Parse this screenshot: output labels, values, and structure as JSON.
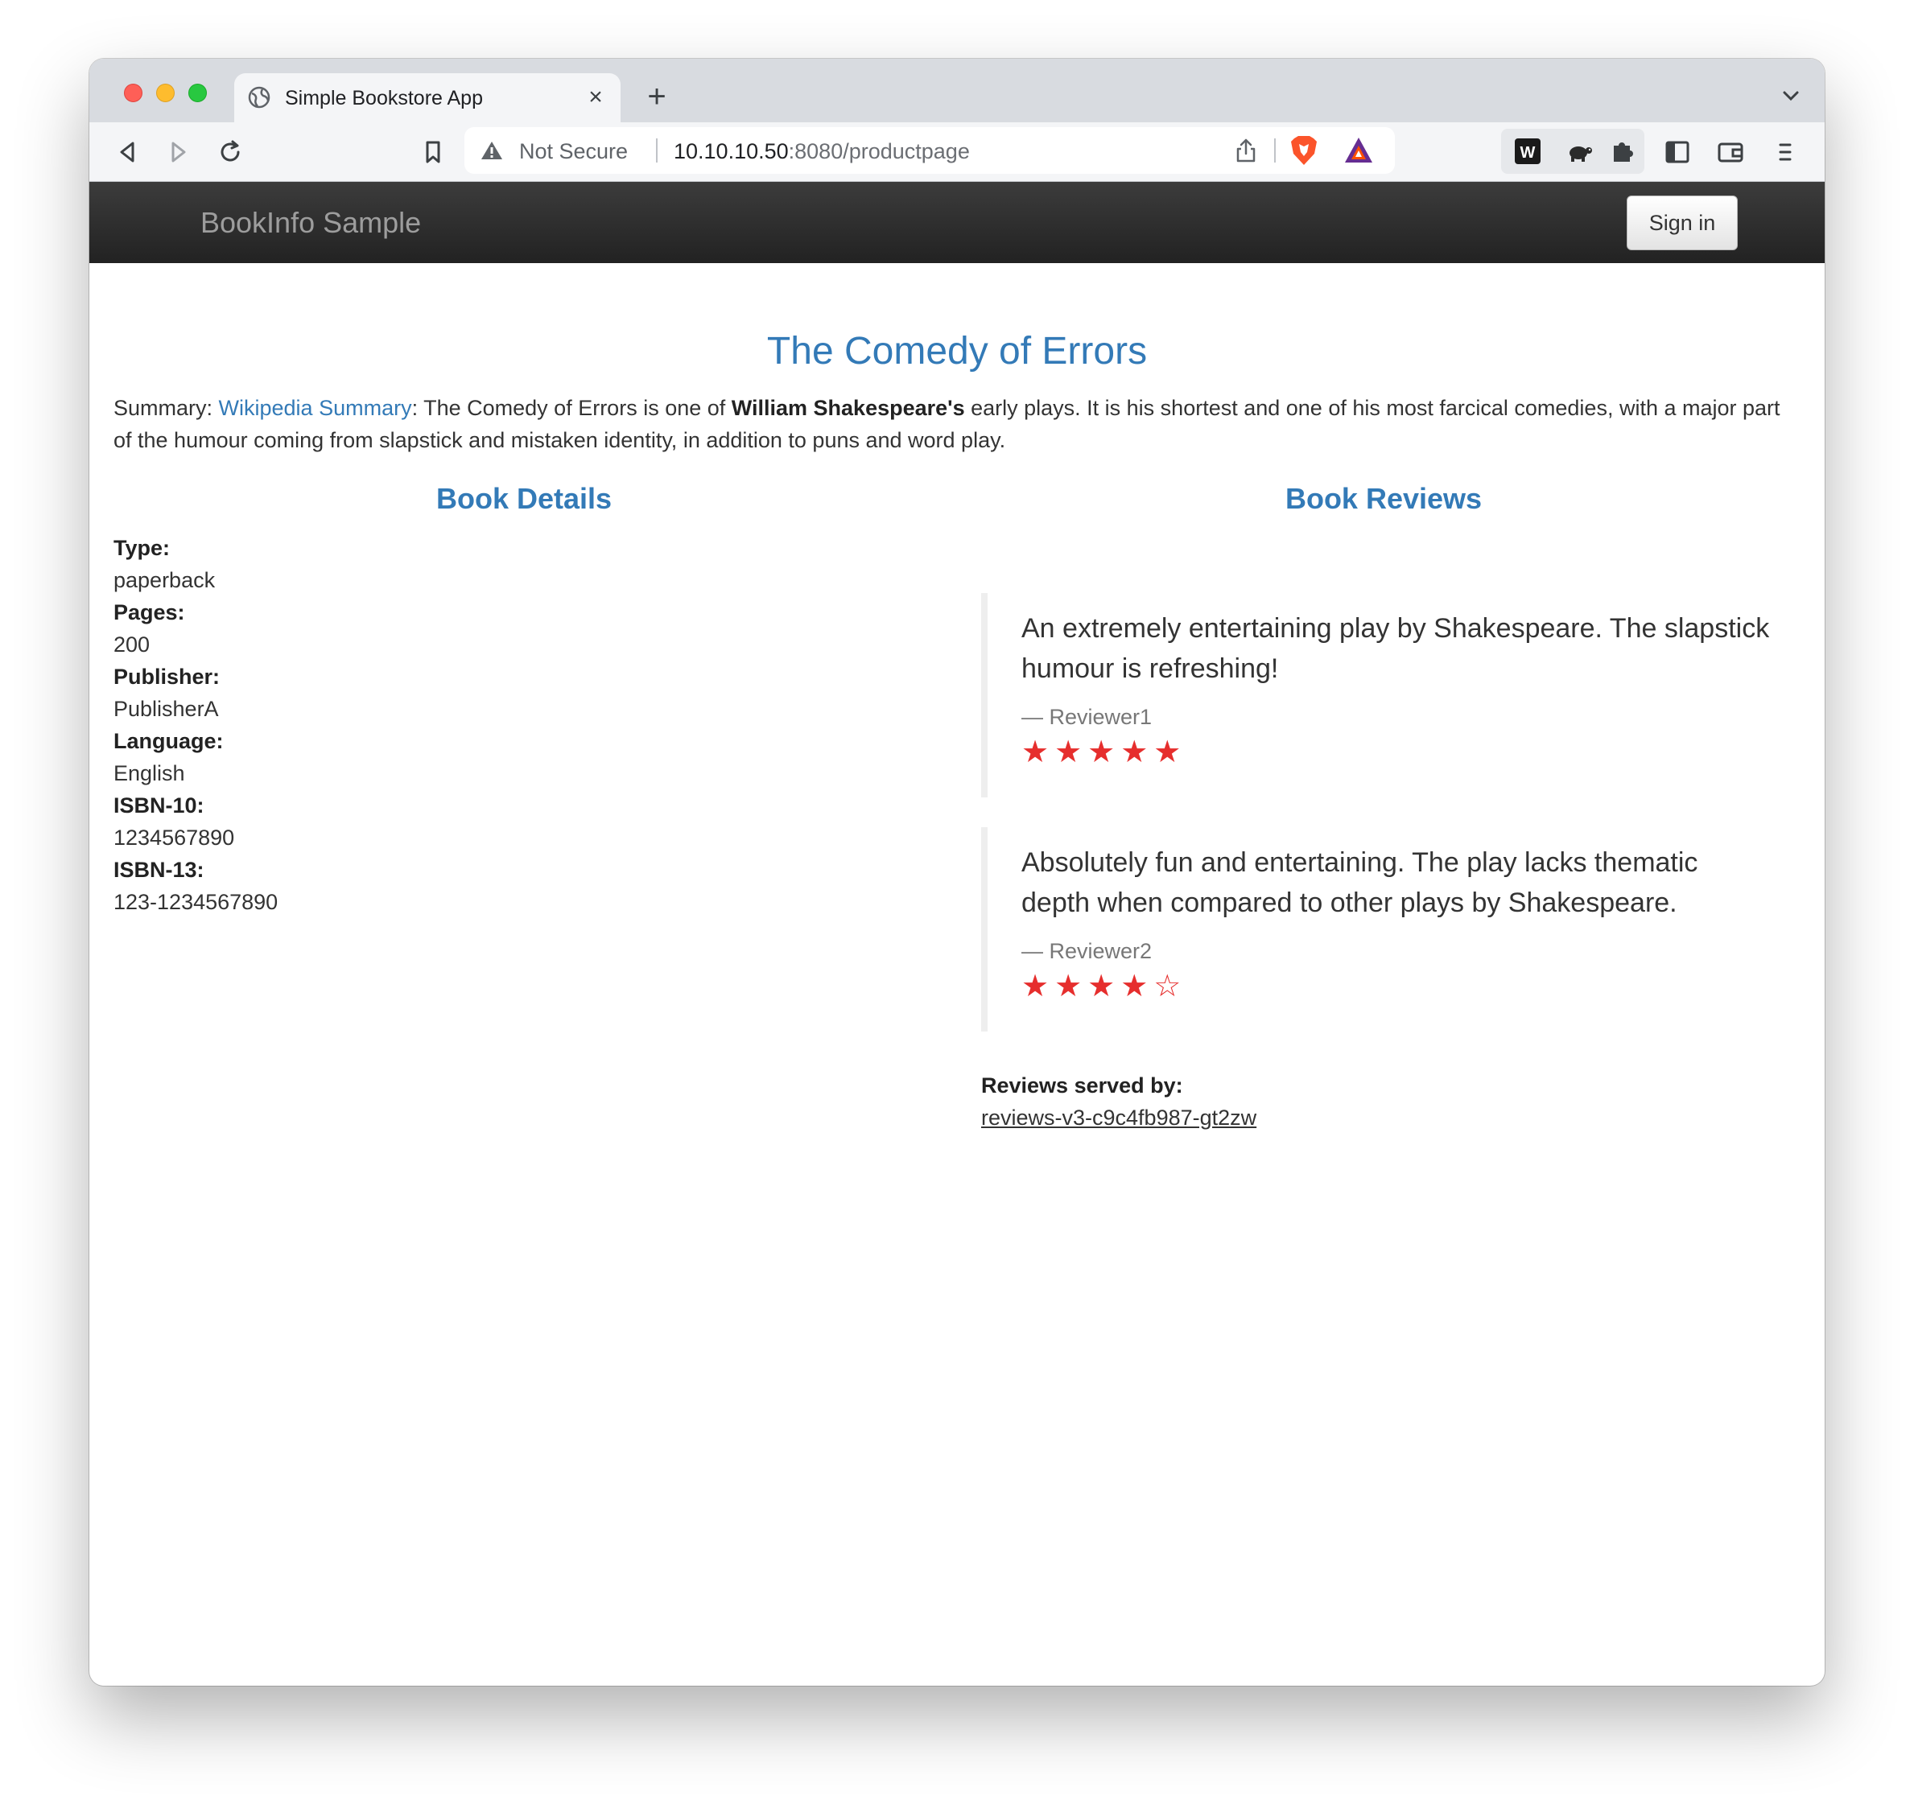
{
  "browser": {
    "tab": {
      "title": "Simple Bookstore App"
    },
    "address": {
      "security_label": "Not Secure",
      "host": "10.10.10.50",
      "path": ":8080/productpage"
    }
  },
  "navbar": {
    "brand": "BookInfo Sample",
    "signin_label": "Sign in"
  },
  "product": {
    "title": "The Comedy of Errors",
    "summary": {
      "label": "Summary: ",
      "link_text": "Wikipedia Summary",
      "text_before_bold": ": The Comedy of Errors is one of ",
      "bold": "William Shakespeare's",
      "text_after_bold": " early plays. It is his shortest and one of his most farcical comedies, with a major part of the humour coming from slapstick and mistaken identity, in addition to puns and word play."
    }
  },
  "details": {
    "heading": "Book Details",
    "fields": [
      {
        "label": "Type:",
        "value": "paperback"
      },
      {
        "label": "Pages:",
        "value": "200"
      },
      {
        "label": "Publisher:",
        "value": "PublisherA"
      },
      {
        "label": "Language:",
        "value": "English"
      },
      {
        "label": "ISBN-10:",
        "value": "1234567890"
      },
      {
        "label": "ISBN-13:",
        "value": "123-1234567890"
      }
    ]
  },
  "reviews": {
    "heading": "Book Reviews",
    "items": [
      {
        "text": "An extremely entertaining play by Shakespeare. The slapstick humour is refreshing!",
        "author": "— Reviewer1",
        "rating": 5,
        "stars": "★★★★★"
      },
      {
        "text": "Absolutely fun and entertaining. The play lacks thematic depth when compared to other plays by Shakespeare.",
        "author": "— Reviewer2",
        "rating": 4,
        "stars": "★★★★☆"
      }
    ],
    "star_color": "#e62e2d",
    "served_by_label": "Reviews served by:",
    "served_by_pod": "reviews-v3-c9c4fb987-gt2zw"
  },
  "colors": {
    "link": "#337ab7",
    "navbar": "#222222"
  }
}
